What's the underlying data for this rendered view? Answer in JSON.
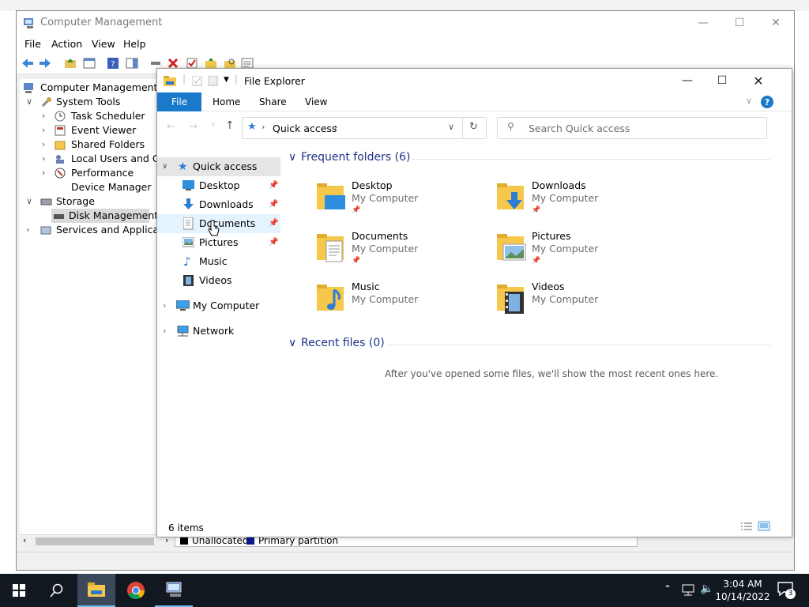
{
  "cm": {
    "title": "Computer Management",
    "menu": [
      "File",
      "Action",
      "View",
      "Help"
    ],
    "tree": {
      "root": "Computer Management (Lo",
      "system_tools": "System Tools",
      "task_scheduler": "Task Scheduler",
      "event_viewer": "Event Viewer",
      "shared_folders": "Shared Folders",
      "local_users": "Local Users and Grou",
      "performance": "Performance",
      "device_manager": "Device Manager",
      "storage": "Storage",
      "disk_management": "Disk Management",
      "services": "Services and Application"
    },
    "legend": {
      "unallocated": "Unallocated",
      "primary": "Primary partition"
    }
  },
  "fe": {
    "title": "File Explorer",
    "tabs": {
      "file": "File",
      "home": "Home",
      "share": "Share",
      "view": "View"
    },
    "address": {
      "segment": "Quick access"
    },
    "search": {
      "placeholder": "Search Quick access"
    },
    "nav": {
      "quick_access": "Quick access",
      "desktop": "Desktop",
      "downloads": "Downloads",
      "documents": "Documents",
      "pictures": "Pictures",
      "music": "Music",
      "videos": "Videos",
      "my_computer": "My Computer",
      "network": "Network"
    },
    "frequent_header": "Frequent folders (6)",
    "folders": [
      {
        "name": "Desktop",
        "location": "My Computer"
      },
      {
        "name": "Downloads",
        "location": "My Computer"
      },
      {
        "name": "Documents",
        "location": "My Computer"
      },
      {
        "name": "Pictures",
        "location": "My Computer"
      },
      {
        "name": "Music",
        "location": "My Computer"
      },
      {
        "name": "Videos",
        "location": "My Computer"
      }
    ],
    "recent_header": "Recent files (0)",
    "recent_empty": "After you've opened some files, we'll show the most recent ones here.",
    "status": "6 items"
  },
  "taskbar": {
    "time": "3:04 AM",
    "date": "10/14/2022",
    "notifications": "3"
  },
  "colors": {
    "accent": "#1979ca",
    "header": "#1e3287",
    "selected": "#e5e5e5",
    "folder": "#f5c84c",
    "taskbar": "#111820"
  }
}
